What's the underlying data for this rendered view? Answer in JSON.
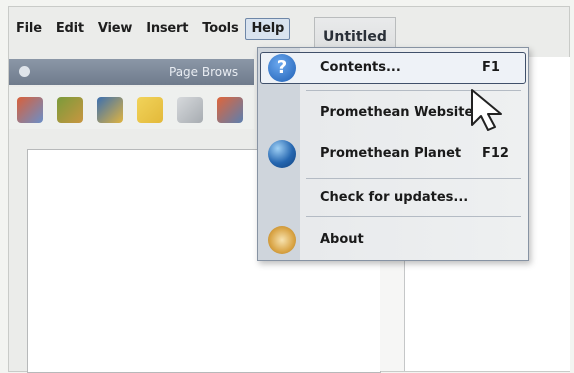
{
  "menubar": {
    "items": [
      "File",
      "Edit",
      "View",
      "Insert",
      "Tools",
      "Help"
    ],
    "active": "Help"
  },
  "doc_tab": {
    "title": "Untitled"
  },
  "panel": {
    "title": "Page Brows"
  },
  "help_menu": {
    "items": [
      {
        "label": "Contents...",
        "shortcut": "F1",
        "icon": "help-question-icon"
      },
      {
        "label": "Promethean Website",
        "shortcut": "",
        "icon": ""
      },
      {
        "label": "Promethean Planet",
        "shortcut": "F12",
        "icon": "globe-icon"
      },
      {
        "label": "Check for updates...",
        "shortcut": "",
        "icon": ""
      },
      {
        "label": "About",
        "shortcut": "",
        "icon": "promethean-logo-icon"
      }
    ]
  },
  "colors": {
    "accent": "#2f6ec0",
    "menu_highlight_border": "#40506a",
    "panel_title": "#7a8696"
  }
}
